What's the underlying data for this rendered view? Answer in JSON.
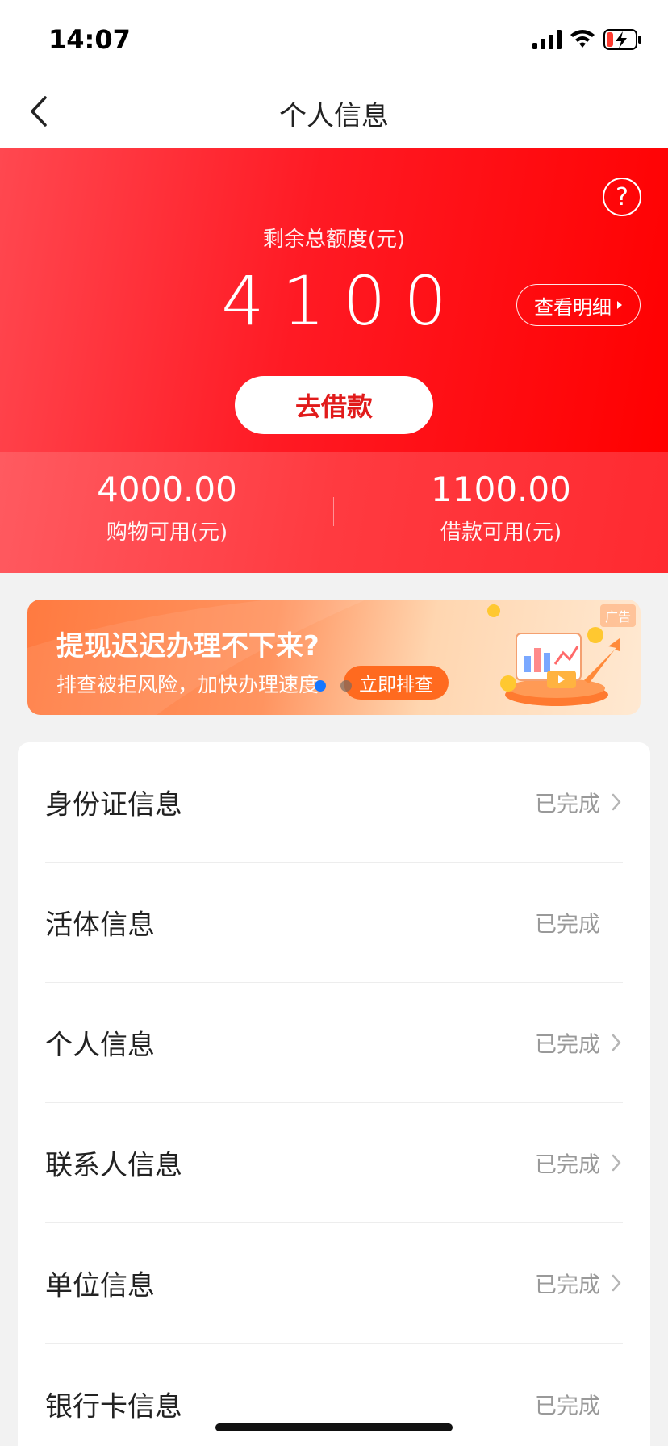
{
  "status_bar": {
    "time": "14:07"
  },
  "nav": {
    "title": "个人信息"
  },
  "hero": {
    "help_symbol": "?",
    "total_label": "剩余总额度(元)",
    "total_amount": "4100",
    "detail_button": "查看明细",
    "borrow_button": "去借款"
  },
  "stats": {
    "shopping_amount": "4000.00",
    "shopping_label": "购物可用(元)",
    "loan_amount": "1100.00",
    "loan_label": "借款可用(元)"
  },
  "banner": {
    "ad_tag": "广告",
    "title": "提现迟迟办理不下来?",
    "subtitle": "排查被拒风险，加快办理速度",
    "button": "立即排查",
    "slides": 2,
    "active_slide": 1
  },
  "info_rows": [
    {
      "label": "身份证信息",
      "status": "已完成",
      "has_arrow": true
    },
    {
      "label": "活体信息",
      "status": "已完成",
      "has_arrow": false
    },
    {
      "label": "个人信息",
      "status": "已完成",
      "has_arrow": true
    },
    {
      "label": "联系人信息",
      "status": "已完成",
      "has_arrow": true
    },
    {
      "label": "单位信息",
      "status": "已完成",
      "has_arrow": true
    },
    {
      "label": "银行卡信息",
      "status": "已完成",
      "has_arrow": false
    }
  ],
  "colors": {
    "brand_red": "#ff1a24",
    "accent_orange": "#ff6a1f",
    "dot_active": "#1677ff",
    "dot_inactive": "#7a6a60"
  }
}
